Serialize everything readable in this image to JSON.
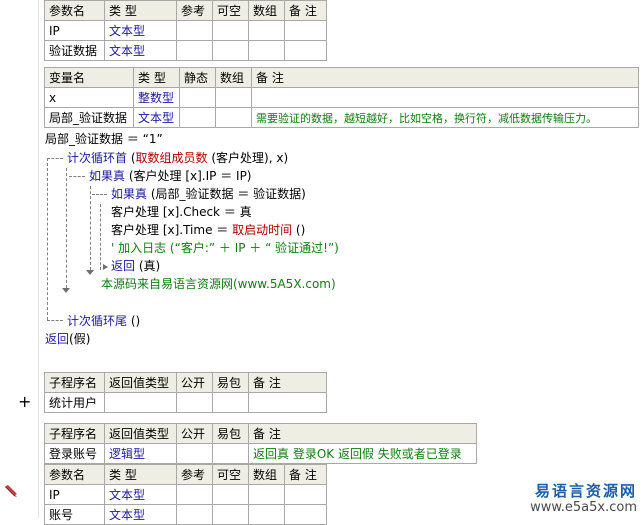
{
  "param_table_top": {
    "headers": [
      "参数名",
      "类 型",
      "参考",
      "可空",
      "数组",
      "备 注"
    ],
    "rows": [
      [
        "IP",
        "文本型",
        "",
        "",
        "",
        ""
      ],
      [
        "验证数据",
        "文本型",
        "",
        "",
        "",
        ""
      ]
    ]
  },
  "var_table": {
    "headers": [
      "变量名",
      "类 型",
      "静态",
      "数组",
      "备 注"
    ],
    "rows": [
      [
        "x",
        "整数型",
        "",
        "",
        ""
      ],
      [
        "局部_验证数据",
        "文本型",
        "",
        "",
        "需要验证的数据，越短越好，比如空格，换行符，减低数据传输压力。"
      ]
    ]
  },
  "code": {
    "l1": "局部_验证数据 ＝ “1”",
    "l2_kw": "计次循环首",
    "l2_fn": "取数组成员数",
    "l2_rest": "(客户处理), x)",
    "l3_kw": "如果真",
    "l3_rest": "(客户处理 [x].IP ＝ IP)",
    "l4_kw": "如果真",
    "l4_rest": "(局部_验证数据 ＝ 验证数据)",
    "l5": "客户处理 [x].Check ＝ 真",
    "l6_a": "客户处理 [x].Time ＝ ",
    "l6_fn": "取启动时间",
    "l6_b": " ()",
    "l7": "' 加入日志 (“客户:” ＋ IP ＋ “ 验证通过!”)",
    "l8_kw": "返回",
    "l8_rest": "(真)",
    "l9": "本源码来自易语言资源网(www.5A5X.com)",
    "l10_kw": "计次循环尾",
    "l10_rest": " ()",
    "l11_kw": "返回",
    "l11_rest": "(假)"
  },
  "sub1": {
    "headers": [
      "子程序名",
      "返回值类型",
      "公开",
      "易包",
      "备 注"
    ],
    "rows": [
      [
        "统计用户",
        "",
        "",
        "",
        ""
      ]
    ]
  },
  "sub2": {
    "headers": [
      "子程序名",
      "返回值类型",
      "公开",
      "易包",
      "备 注"
    ],
    "rows": [
      [
        "登录账号",
        "逻辑型",
        "",
        "",
        "返回真 登录OK  返回假 失败或者已登录"
      ]
    ]
  },
  "param_table_bottom": {
    "headers": [
      "参数名",
      "类 型",
      "参考",
      "可空",
      "数组",
      "备 注"
    ],
    "rows": [
      [
        "IP",
        "文本型",
        "",
        "",
        "",
        ""
      ],
      [
        "账号",
        "文本型",
        "",
        "",
        "",
        ""
      ]
    ]
  },
  "gutter": {
    "expand_symbol": "+"
  },
  "watermark": {
    "line1": "易语言资源网",
    "line2": "www.e5a5x.com"
  },
  "colors": {
    "keyword_blue": "#1b1ba0",
    "comment_green": "#107c10",
    "function_red": "#b00000",
    "header_bg": "#eeeee4",
    "grid": "#a8a8a8"
  }
}
